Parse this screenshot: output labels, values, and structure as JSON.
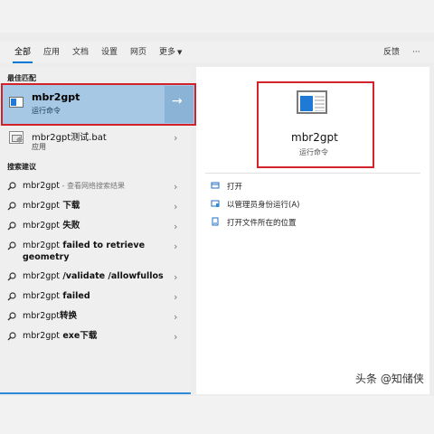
{
  "tabs": [
    {
      "label": "全部"
    },
    {
      "label": "应用"
    },
    {
      "label": "文档"
    },
    {
      "label": "设置"
    },
    {
      "label": "网页"
    },
    {
      "label": "更多"
    }
  ],
  "feedback_label": "反馈",
  "more_options_label": "···",
  "best_match": {
    "heading": "最佳匹配",
    "title": "mbr2gpt",
    "subtitle": "运行命令",
    "arrow": "→"
  },
  "bat_item": {
    "title": "mbr2gpt测试.bat",
    "subtitle": "应用"
  },
  "suggestions_heading": "搜索建议",
  "suggestions": [
    {
      "text": "mbr2gpt",
      "extra": " - 查看网络搜索结果"
    },
    {
      "text": "mbr2gpt",
      "extra_bold": " 下载"
    },
    {
      "text": "mbr2gpt",
      "extra_bold": " 失败"
    },
    {
      "text": "mbr2gpt",
      "extra_bold": " failed to retrieve geometry"
    },
    {
      "text": "mbr2gpt",
      "extra_bold": " /validate /allowfullos"
    },
    {
      "text": "mbr2gpt",
      "extra_bold": " failed"
    },
    {
      "text": "mbr2gpt",
      "extra_bold": "转换"
    },
    {
      "text": "mbr2gpt",
      "extra_bold": " exe下载"
    }
  ],
  "preview": {
    "title": "mbr2gpt",
    "subtitle": "运行命令"
  },
  "actions": [
    {
      "label": "打开",
      "icon": "open-icon"
    },
    {
      "label": "以管理员身份运行(A)",
      "icon": "shield-icon"
    },
    {
      "label": "打开文件所在的位置",
      "icon": "file-location-icon"
    }
  ],
  "watermark": "头条 @知储侠",
  "colors": {
    "accent": "#0078d7",
    "highlight": "#a6c8e4",
    "annotation_red": "#d2222a"
  }
}
